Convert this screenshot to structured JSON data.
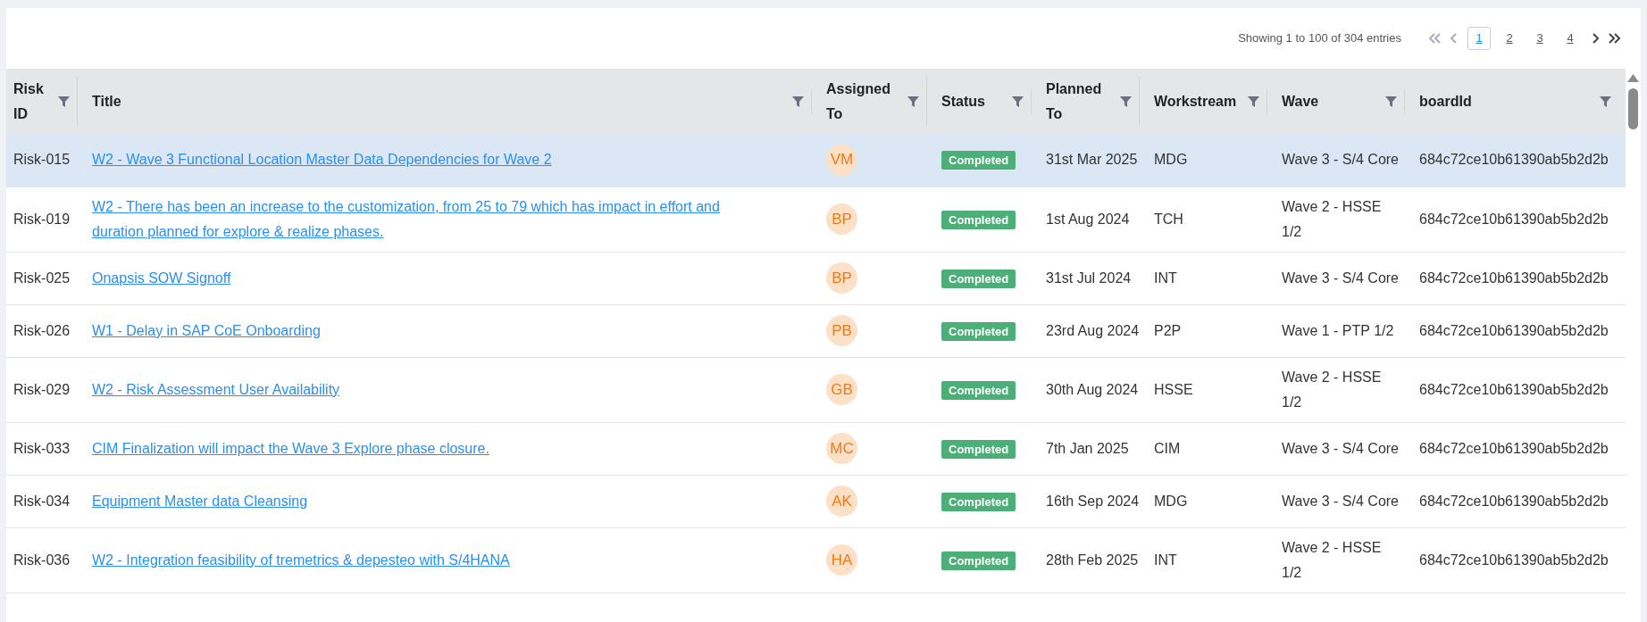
{
  "pagination": {
    "summary": "Showing 1 to 100 of 304 entries",
    "pages": [
      {
        "label": "1",
        "selected": true
      },
      {
        "label": "2",
        "selected": false
      },
      {
        "label": "3",
        "selected": false
      },
      {
        "label": "4",
        "selected": false
      }
    ]
  },
  "table": {
    "columns": [
      "Risk ID",
      "Title",
      "Assigned To",
      "Status",
      "Planned To",
      "Workstream",
      "Wave",
      "boardId"
    ],
    "rows": [
      {
        "id": "Risk-015",
        "title": "W2 - Wave 3 Functional Location Master Data Dependencies for Wave 2",
        "assigned": "VM",
        "status": "Completed",
        "planned": "31st Mar 2025",
        "workstream": "MDG",
        "wave": "Wave 3 - S/4 Core",
        "board_id": "684c72ce10b61390ab5b2d2b",
        "selected": true
      },
      {
        "id": "Risk-019",
        "title": "W2 - There has been an increase to the customization, from 25 to 79 which has impact in effort and duration planned for explore & realize phases.",
        "assigned": "BP",
        "status": "Completed",
        "planned": "1st Aug 2024",
        "workstream": "TCH",
        "wave": "Wave 2 - HSSE 1/2",
        "board_id": "684c72ce10b61390ab5b2d2b",
        "selected": false
      },
      {
        "id": "Risk-025",
        "title": "Onapsis SOW Signoff",
        "assigned": "BP",
        "status": "Completed",
        "planned": "31st Jul 2024",
        "workstream": "INT",
        "wave": "Wave 3 - S/4 Core",
        "board_id": "684c72ce10b61390ab5b2d2b",
        "selected": false
      },
      {
        "id": "Risk-026",
        "title": "W1 - Delay in SAP CoE Onboarding",
        "assigned": "PB",
        "status": "Completed",
        "planned": "23rd Aug 2024",
        "workstream": "P2P",
        "wave": "Wave 1 - PTP 1/2",
        "board_id": "684c72ce10b61390ab5b2d2b",
        "selected": false
      },
      {
        "id": "Risk-029",
        "title": "W2 - Risk Assessment User Availability",
        "assigned": "GB",
        "status": "Completed",
        "planned": "30th Aug 2024",
        "workstream": "HSSE",
        "wave": "Wave 2 - HSSE 1/2",
        "board_id": "684c72ce10b61390ab5b2d2b",
        "selected": false
      },
      {
        "id": "Risk-033",
        "title": "CIM Finalization will impact the Wave 3 Explore phase closure.",
        "assigned": "MC",
        "status": "Completed",
        "planned": "7th Jan 2025",
        "workstream": "CIM",
        "wave": "Wave 3 - S/4 Core",
        "board_id": "684c72ce10b61390ab5b2d2b",
        "selected": false
      },
      {
        "id": "Risk-034",
        "title": "Equipment Master data Cleansing",
        "assigned": "AK",
        "status": "Completed",
        "planned": "16th Sep 2024",
        "workstream": "MDG",
        "wave": "Wave 3 - S/4 Core",
        "board_id": "684c72ce10b61390ab5b2d2b",
        "selected": false
      },
      {
        "id": "Risk-036",
        "title": "W2 - Integration feasibility of tremetrics & depesteo with S/4HANA",
        "assigned": "HA",
        "status": "Completed",
        "planned": "28th Feb 2025",
        "workstream": "INT",
        "wave": "Wave 2 - HSSE 1/2",
        "board_id": "684c72ce10b61390ab5b2d2b",
        "selected": false
      }
    ]
  }
}
